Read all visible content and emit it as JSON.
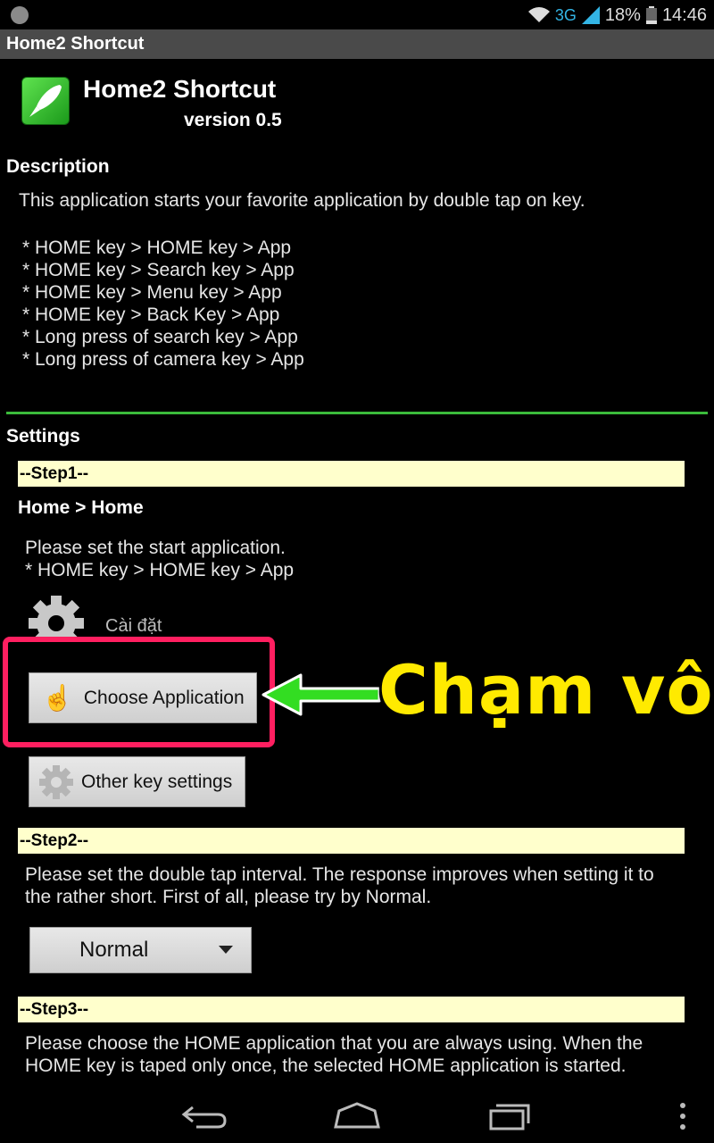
{
  "status_bar": {
    "network": "3G",
    "battery": "18%",
    "time": "14:46"
  },
  "title_bar": {
    "title": "Home2 Shortcut"
  },
  "app_header": {
    "name": "Home2 Shortcut",
    "version": "version 0.5"
  },
  "description": {
    "heading": "Description",
    "text": "This application starts your favorite application by double tap on key.",
    "items": [
      "* HOME key > HOME key > App",
      "* HOME key > Search key > App",
      "* HOME key > Menu key > App",
      "* HOME key > Back Key > App",
      "* Long press of search key > App",
      "* Long press of camera key > App"
    ]
  },
  "settings": {
    "heading": "Settings",
    "step1": {
      "label": "--Step1--",
      "subheading": "Home > Home",
      "text_line1": "Please set the start application.",
      "text_line2": " * HOME key > HOME key > App",
      "current_app": "Cài đặt",
      "choose_button": "Choose Application",
      "other_button": "Other key settings"
    },
    "step2": {
      "label": "--Step2--",
      "text_line1": "Please set the double tap interval. The response improves when setting it to",
      "text_line2": "the rather short. First of all, please try by Normal.",
      "dropdown_value": "Normal"
    },
    "step3": {
      "label": "--Step3--",
      "text_line1": "Please choose the HOME application that you are always using. When the",
      "text_line2": "HOME key is taped only once, the selected HOME application is started."
    }
  },
  "annotation": {
    "callout_text": "Chạm vô",
    "highlight_color": "#ff1f60",
    "arrow_color": "#33dd22",
    "callout_color": "#ffea00"
  }
}
